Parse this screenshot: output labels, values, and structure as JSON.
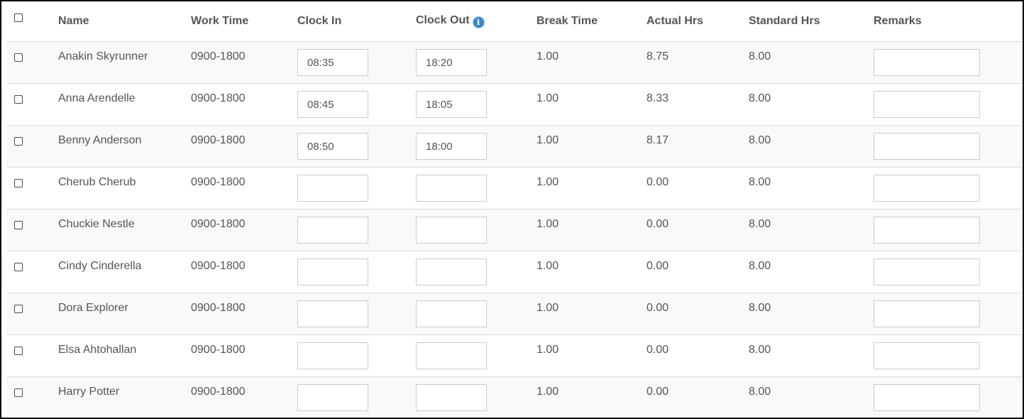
{
  "columns": {
    "name": "Name",
    "work_time": "Work Time",
    "clock_in": "Clock In",
    "clock_out": "Clock Out",
    "break_time": "Break Time",
    "actual_hrs": "Actual Hrs",
    "standard_hrs": "Standard Hrs",
    "remarks": "Remarks"
  },
  "icons": {
    "clock_out_info": "info-icon"
  },
  "rows": [
    {
      "name": "Anakin Skyrunner",
      "work_time": "0900-1800",
      "clock_in": "08:35",
      "clock_out": "18:20",
      "break_time": "1.00",
      "actual_hrs": "8.75",
      "standard_hrs": "8.00",
      "remarks": ""
    },
    {
      "name": "Anna Arendelle",
      "work_time": "0900-1800",
      "clock_in": "08:45",
      "clock_out": "18:05",
      "break_time": "1.00",
      "actual_hrs": "8.33",
      "standard_hrs": "8.00",
      "remarks": ""
    },
    {
      "name": "Benny Anderson",
      "work_time": "0900-1800",
      "clock_in": "08:50",
      "clock_out": "18:00",
      "break_time": "1.00",
      "actual_hrs": "8.17",
      "standard_hrs": "8.00",
      "remarks": ""
    },
    {
      "name": "Cherub Cherub",
      "work_time": "0900-1800",
      "clock_in": "",
      "clock_out": "",
      "break_time": "1.00",
      "actual_hrs": "0.00",
      "standard_hrs": "8.00",
      "remarks": ""
    },
    {
      "name": "Chuckie Nestle",
      "work_time": "0900-1800",
      "clock_in": "",
      "clock_out": "",
      "break_time": "1.00",
      "actual_hrs": "0.00",
      "standard_hrs": "8.00",
      "remarks": ""
    },
    {
      "name": "Cindy Cinderella",
      "work_time": "0900-1800",
      "clock_in": "",
      "clock_out": "",
      "break_time": "1.00",
      "actual_hrs": "0.00",
      "standard_hrs": "8.00",
      "remarks": ""
    },
    {
      "name": "Dora Explorer",
      "work_time": "0900-1800",
      "clock_in": "",
      "clock_out": "",
      "break_time": "1.00",
      "actual_hrs": "0.00",
      "standard_hrs": "8.00",
      "remarks": ""
    },
    {
      "name": "Elsa Ahtohallan",
      "work_time": "0900-1800",
      "clock_in": "",
      "clock_out": "",
      "break_time": "1.00",
      "actual_hrs": "0.00",
      "standard_hrs": "8.00",
      "remarks": ""
    },
    {
      "name": "Harry Potter",
      "work_time": "0900-1800",
      "clock_in": "",
      "clock_out": "",
      "break_time": "1.00",
      "actual_hrs": "0.00",
      "standard_hrs": "8.00",
      "remarks": ""
    }
  ]
}
